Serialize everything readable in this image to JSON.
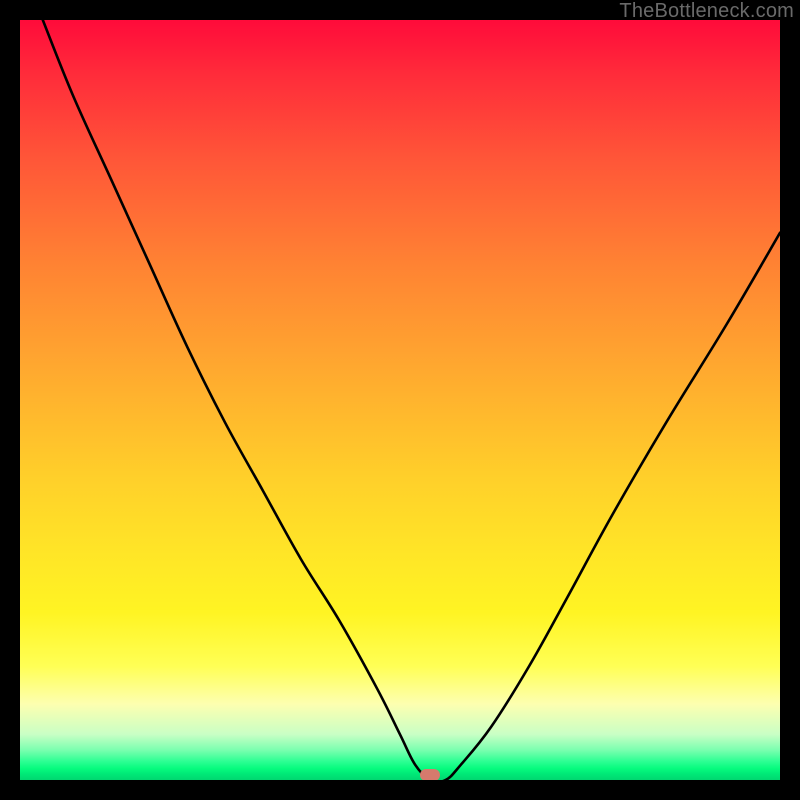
{
  "attribution": "TheBottleneck.com",
  "marker": {
    "x_pct": 54.0,
    "y_pct": 99.3
  },
  "chart_data": {
    "type": "line",
    "title": "",
    "xlabel": "",
    "ylabel": "",
    "xlim": [
      0,
      100
    ],
    "ylim": [
      0,
      100
    ],
    "grid": false,
    "legend": false,
    "x": [
      3,
      7,
      12,
      17,
      22,
      27,
      32,
      37,
      42,
      47,
      50,
      52,
      54,
      56,
      58,
      62,
      67,
      72,
      78,
      85,
      93,
      100
    ],
    "values": [
      100,
      90,
      79,
      68,
      57,
      47,
      38,
      29,
      21,
      12,
      6,
      2,
      0,
      0,
      2,
      7,
      15,
      24,
      35,
      47,
      60,
      72
    ],
    "series": [
      {
        "name": "bottleneck-curve",
        "x": [
          3,
          7,
          12,
          17,
          22,
          27,
          32,
          37,
          42,
          47,
          50,
          52,
          54,
          56,
          58,
          62,
          67,
          72,
          78,
          85,
          93,
          100
        ],
        "values": [
          100,
          90,
          79,
          68,
          57,
          47,
          38,
          29,
          21,
          12,
          6,
          2,
          0,
          0,
          2,
          7,
          15,
          24,
          35,
          47,
          60,
          72
        ]
      }
    ],
    "annotations": [
      {
        "type": "marker",
        "x": 54,
        "y": 0,
        "color": "#d57a6d"
      }
    ]
  }
}
